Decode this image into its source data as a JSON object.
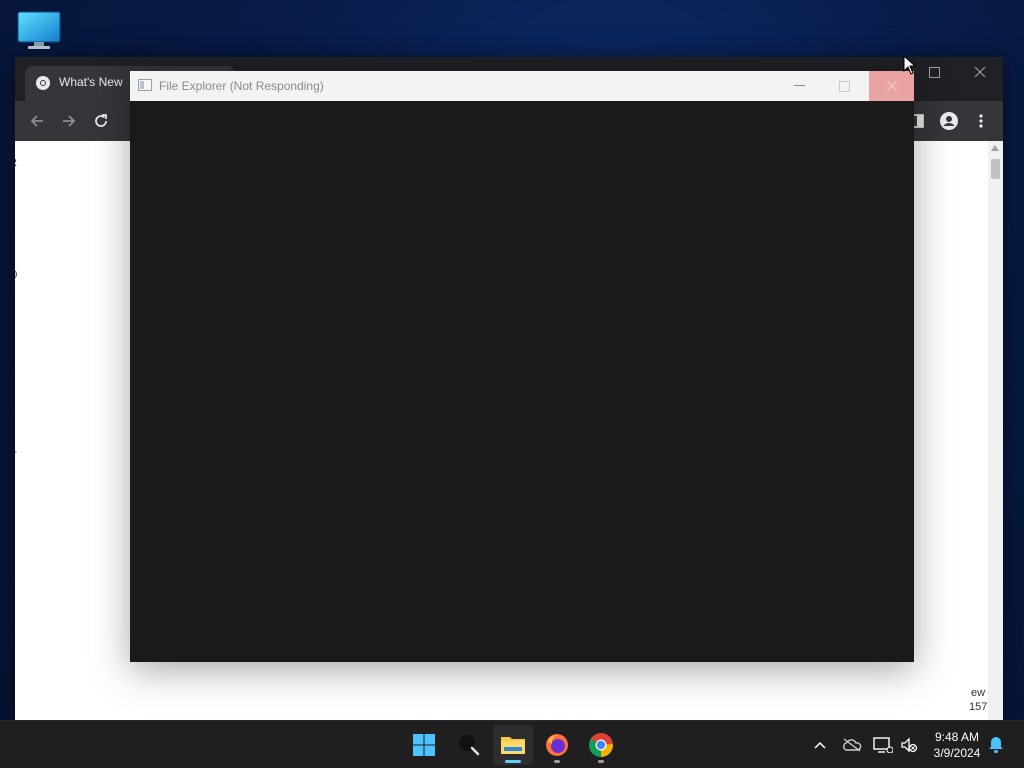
{
  "desktop": {
    "icons": [
      {
        "name": "This PC",
        "icon": "monitor-icon"
      }
    ]
  },
  "chrome": {
    "tab_title": "What's New",
    "page_fragments": {
      "f1": "R",
      "f2": "Vi",
      "f3": "20",
      "f4": "T",
      "f5": "ew",
      "f6": "157"
    }
  },
  "file_explorer": {
    "title": "File Explorer (Not Responding)",
    "state": "not-responding"
  },
  "taskbar": {
    "apps": [
      {
        "name": "Start",
        "icon": "windows-logo-icon"
      },
      {
        "name": "Search",
        "icon": "search-icon"
      },
      {
        "name": "File Explorer",
        "icon": "folder-icon",
        "active": true
      },
      {
        "name": "Firefox",
        "icon": "firefox-icon",
        "running": true
      },
      {
        "name": "Google Chrome",
        "icon": "chrome-icon",
        "running": true
      }
    ],
    "tray": {
      "time": "9:48 AM",
      "date": "3/9/2024"
    }
  },
  "colors": {
    "taskbar_bg": "#1f1f1f",
    "chrome_dark": "#202124",
    "close_hover": "#eaa3a3",
    "active_indicator": "#60cdff",
    "running_indicator": "#9e9e9e"
  }
}
